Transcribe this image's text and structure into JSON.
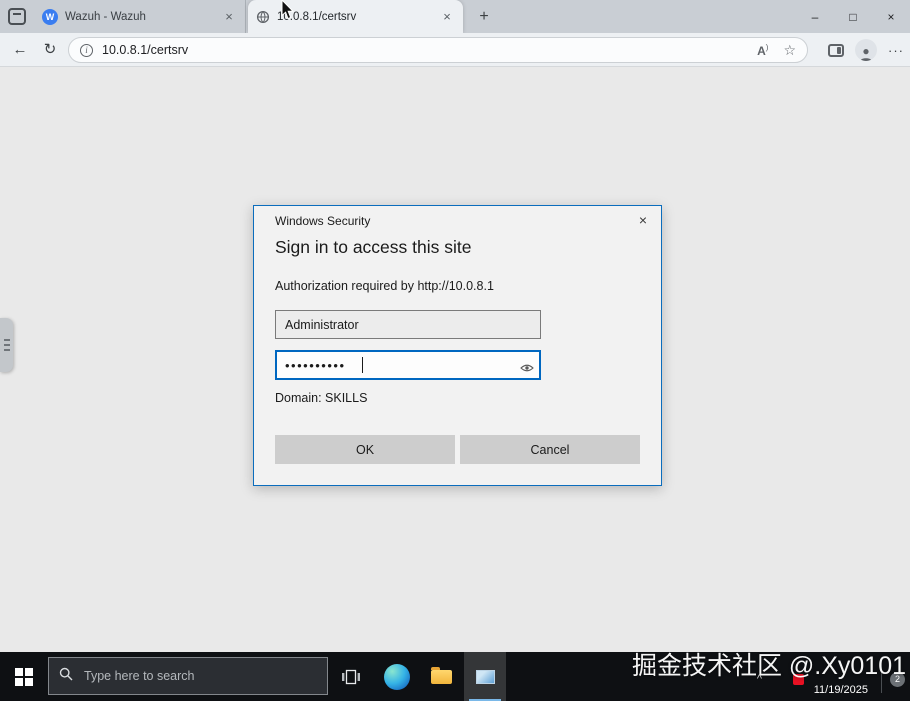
{
  "browser": {
    "tabs": [
      {
        "title": "Wazuh - Wazuh",
        "favicon_letter": "W"
      },
      {
        "title": "10.0.8.1/certsrv"
      }
    ],
    "url": "10.0.8.1/certsrv"
  },
  "glyphs": {
    "close": "×",
    "plus": "+",
    "back": "←",
    "refresh": "↻",
    "info": "i",
    "read_aloud": "A",
    "star": "☆",
    "more": "···",
    "minimize": "–",
    "maximize": "□",
    "chevron_up": "^"
  },
  "dialog": {
    "title": "Windows Security",
    "heading": "Sign in to access this site",
    "message": "Authorization required by http://10.0.8.1",
    "username_value": "Administrator",
    "password_masked": "••••••••••",
    "domain_label": "Domain: SKILLS",
    "ok_label": "OK",
    "cancel_label": "Cancel"
  },
  "taskbar": {
    "search_placeholder": "Type here to search",
    "date": "11/19/2025",
    "notification_count": "2"
  },
  "watermark": {
    "text": "掘金技术社区 @.Xy0101"
  },
  "colors": {
    "accent_blue": "#0067c0",
    "dialog_border": "#0b6dbd",
    "wazuh_blue": "#3a7df0",
    "taskbar_bg": "#0e1013",
    "page_bg": "#e9e9e9",
    "red_tray": "#e81123"
  }
}
